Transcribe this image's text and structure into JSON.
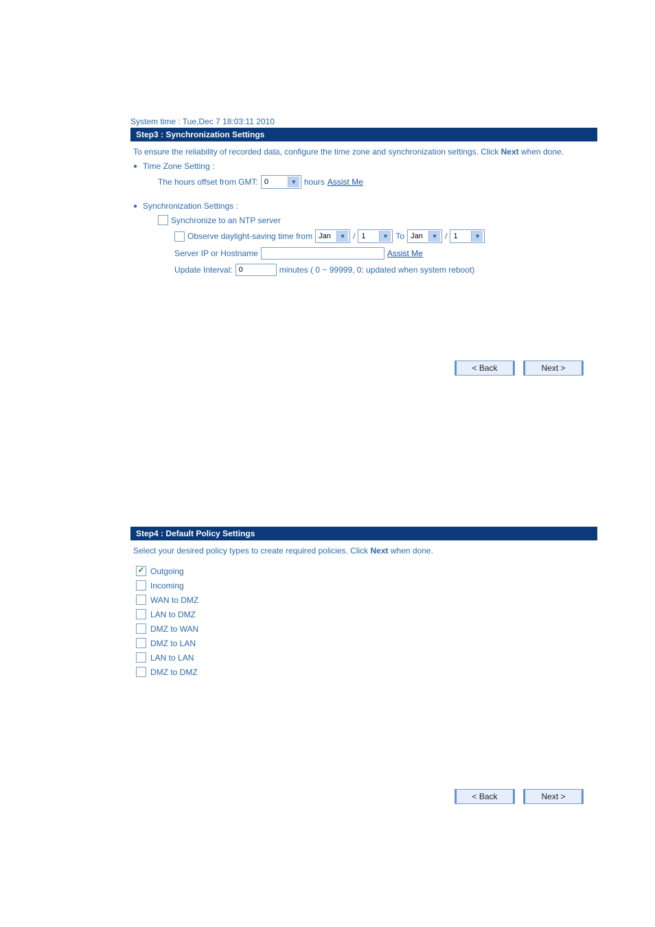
{
  "system_time": "System time : Tue,Dec 7 18:03:11 2010",
  "step3": {
    "title": "Step3 : Synchronization Settings",
    "desc_pre": "To ensure the reliability of recorded data, configure the time zone and synchronization settings. Click ",
    "desc_bold": "Next",
    "desc_post": " when done.",
    "time_zone_heading": "Time Zone Setting :",
    "gmt_label": "The hours offset from GMT:",
    "gmt_value": "0",
    "hours_text": "hours",
    "assist_me": "Assist Me",
    "sync_heading": "Synchronization Settings :",
    "ntp_checkbox_label": "Synchronize to an NTP server",
    "dst_label": "Observe daylight-saving time from",
    "dst_from_month": "Jan",
    "dst_from_day": "1",
    "dst_to_label": "To",
    "dst_to_month": "Jan",
    "dst_to_day": "1",
    "server_label": "Server IP or Hostname",
    "server_value": "",
    "assist_me2": "Assist Me",
    "update_label": "Update Interval:",
    "update_value": "0",
    "update_hint": "minutes  ( 0 ~ 99999, 0: updated when system reboot)",
    "back": "< Back",
    "next": "Next >"
  },
  "step4": {
    "title": "Step4 : Default Policy Settings",
    "desc_pre": "Select your desired policy types to create required policies. Click ",
    "desc_bold": "Next",
    "desc_post": " when done.",
    "policies": [
      {
        "label": "Outgoing",
        "checked": true
      },
      {
        "label": "Incoming",
        "checked": false
      },
      {
        "label": "WAN to DMZ",
        "checked": false
      },
      {
        "label": "LAN to DMZ",
        "checked": false
      },
      {
        "label": "DMZ to WAN",
        "checked": false
      },
      {
        "label": "DMZ to LAN",
        "checked": false
      },
      {
        "label": "LAN to LAN",
        "checked": false
      },
      {
        "label": "DMZ to DMZ",
        "checked": false
      }
    ],
    "back": "< Back",
    "next": "Next >"
  }
}
